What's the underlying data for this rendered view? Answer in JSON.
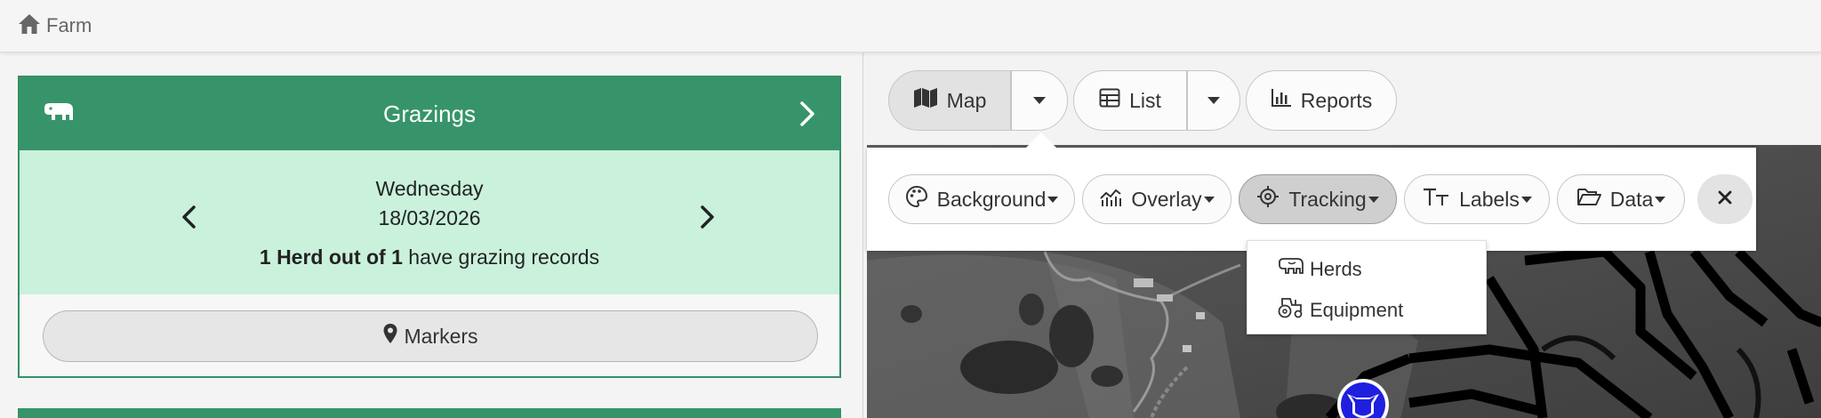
{
  "breadcrumb": {
    "home_label": "Farm"
  },
  "grazings_card": {
    "title": "Grazings",
    "day": "Wednesday",
    "date": "18/03/2026",
    "summary_bold": "1 Herd out of 1",
    "summary_rest": " have grazing records",
    "markers_label": "Markers"
  },
  "view_toolbar": {
    "map_label": "Map",
    "list_label": "List",
    "reports_label": "Reports"
  },
  "layers_toolbar": {
    "background_label": "Background",
    "overlay_label": "Overlay",
    "tracking_label": "Tracking",
    "labels_label": "Labels",
    "data_label": "Data"
  },
  "tracking_menu": {
    "items": [
      {
        "label": "Herds",
        "icon": "cow-icon"
      },
      {
        "label": "Equipment",
        "icon": "tractor-icon"
      }
    ]
  },
  "colors": {
    "card_header": "#37946a",
    "card_body": "#c9f1dc",
    "herd_marker": "#1f1fe0"
  }
}
